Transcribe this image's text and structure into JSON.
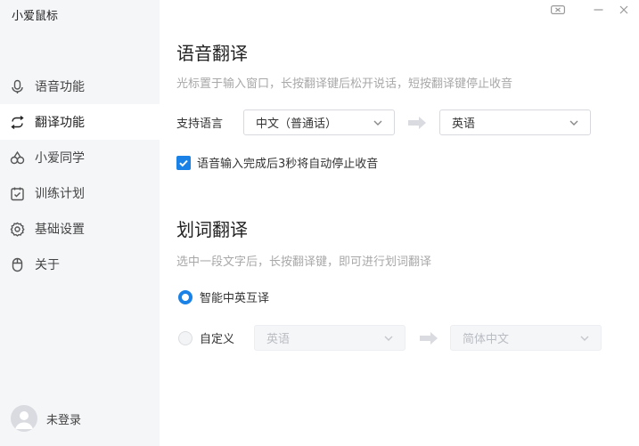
{
  "app": {
    "title": "小爱鼠标"
  },
  "sidebar": {
    "items": [
      {
        "label": "语音功能",
        "icon": "microphone-icon",
        "active": false
      },
      {
        "label": "翻译功能",
        "icon": "translate-icon",
        "active": true
      },
      {
        "label": "小爱同学",
        "icon": "xiaoai-icon",
        "active": false
      },
      {
        "label": "训练计划",
        "icon": "calendar-check-icon",
        "active": false
      },
      {
        "label": "基础设置",
        "icon": "gear-icon",
        "active": false
      },
      {
        "label": "关于",
        "icon": "mouse-icon",
        "active": false
      }
    ],
    "user": {
      "label": "未登录",
      "icon": "avatar-icon"
    }
  },
  "voice_translate": {
    "title": "语音翻译",
    "hint": "光标置于输入窗口，长按翻译键后松开说话，短按翻译键停止收音",
    "language_label": "支持语言",
    "source_language": "中文（普通话）",
    "target_language": "英语",
    "auto_stop_label": "语音输入完成后3秒将自动停止收音",
    "auto_stop_checked": true
  },
  "word_translate": {
    "title": "划词翻译",
    "hint": "选中一段文字后，长按翻译键，即可进行划词翻译",
    "option_smart": "智能中英互译",
    "option_custom": "自定义",
    "selected": "smart",
    "custom_source": "英语",
    "custom_target": "简体中文"
  },
  "colors": {
    "accent": "#1a82e6",
    "sidebar_bg": "#f5f6f8"
  }
}
